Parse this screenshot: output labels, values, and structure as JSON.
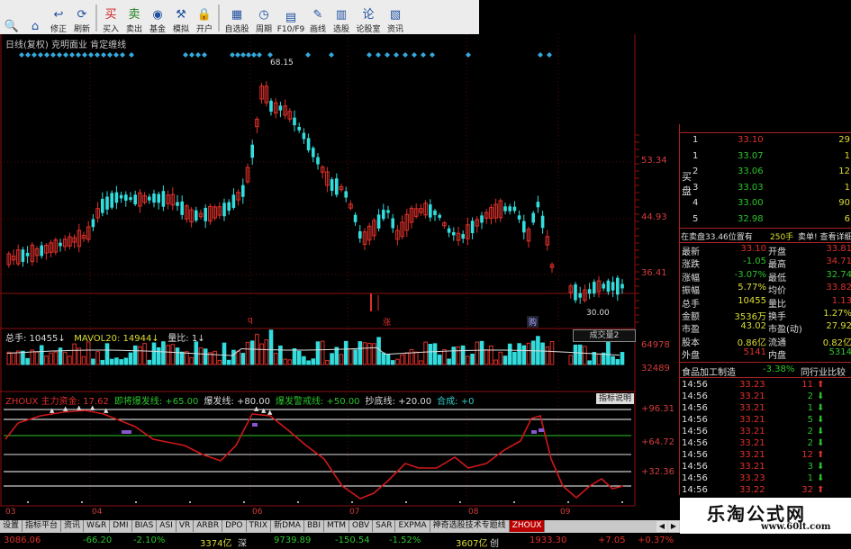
{
  "toolbar": {
    "buttons": [
      {
        "label": "",
        "icon": "search-icon",
        "glyph": "🔍"
      },
      {
        "label": "",
        "icon": "home-icon",
        "glyph": "⌂"
      },
      {
        "label": "修正",
        "icon": "back-arrow-icon",
        "glyph": "↩"
      },
      {
        "label": "刷新",
        "icon": "refresh-icon",
        "glyph": "⟳"
      },
      {
        "label": "买入",
        "icon": "buy-icon",
        "glyph": "买"
      },
      {
        "label": "卖出",
        "icon": "sell-icon",
        "glyph": "卖"
      },
      {
        "label": "基金",
        "icon": "fund-icon",
        "glyph": "◉"
      },
      {
        "label": "模拟",
        "icon": "simulate-icon",
        "glyph": "⚒"
      },
      {
        "label": "开户",
        "icon": "lock-icon",
        "glyph": "🔒"
      },
      {
        "label": "自选股",
        "icon": "favorite-icon",
        "glyph": "▦"
      },
      {
        "label": "周期",
        "icon": "period-icon",
        "glyph": "◷"
      },
      {
        "label": "F10/F9",
        "icon": "f10-icon",
        "glyph": "▤"
      },
      {
        "label": "画线",
        "icon": "draw-line-icon",
        "glyph": "✎"
      },
      {
        "label": "选股",
        "icon": "stock-pick-icon",
        "glyph": "▥"
      },
      {
        "label": "论股室",
        "icon": "forum-icon",
        "glyph": "论"
      },
      {
        "label": "资讯",
        "icon": "news-icon",
        "glyph": "▧"
      }
    ]
  },
  "chart": {
    "title": "日线(复权) 克明面业 肯定缠线",
    "price_labels": [
      "53.34",
      "44.93",
      "36.41"
    ],
    "high_label": "68.15",
    "low_label": "30.00",
    "month_labels": [
      "03",
      "04",
      "06",
      "07",
      "08",
      "09"
    ],
    "event_markers": [
      "q",
      "涨",
      "购"
    ]
  },
  "volume": {
    "header": {
      "total_label": "总手: 10455",
      "mavol_label": "MAVOL20: 14944",
      "ratio_label": "量比: 1"
    },
    "axis_labels": [
      "64978",
      "32489"
    ],
    "button_label": "成交量2"
  },
  "indicator": {
    "name": "ZHOUX",
    "items": [
      {
        "label": "主力资金:",
        "value": "17.62",
        "color": "#e0302a"
      },
      {
        "label": "即将爆发线:",
        "value": "+65.00",
        "color": "#2cc52c"
      },
      {
        "label": "爆发线:",
        "value": "+80.00",
        "color": "#dddddd"
      },
      {
        "label": "爆发警戒线:",
        "value": "+50.00",
        "color": "#2cc52c"
      },
      {
        "label": "抄底线:",
        "value": "+20.00",
        "color": "#dddddd"
      },
      {
        "label": "合成:",
        "value": "+0",
        "color": "#33cccc"
      }
    ],
    "axis_labels": [
      "+96.31",
      "+64.72",
      "+32.36"
    ],
    "help_label": "指标说明"
  },
  "quote_panel": {
    "book_label_buy": "买",
    "book_label_pan": "盘",
    "book_rows": [
      {
        "level": "1",
        "price": "33.10",
        "vol": "29",
        "pcolor": "#e0302a"
      },
      {
        "level": "1",
        "price": "33.07",
        "vol": "1",
        "pcolor": "#2cc52c"
      },
      {
        "level": "2",
        "price": "33.06",
        "vol": "12",
        "pcolor": "#2cc52c"
      },
      {
        "level": "3",
        "price": "33.03",
        "vol": "1",
        "pcolor": "#2cc52c"
      },
      {
        "level": "4",
        "price": "33.00",
        "vol": "90",
        "pcolor": "#2cc52c"
      },
      {
        "level": "5",
        "price": "32.98",
        "vol": "6",
        "pcolor": "#2cc52c"
      }
    ],
    "banner": {
      "left": "在卖盘33.46位置有",
      "mid": "250手",
      "right": "卖单! 查看详细"
    },
    "stats": [
      {
        "k1": "最新",
        "v1": "33.10",
        "c1": "#e0302a",
        "k2": "开盘",
        "v2": "33.81",
        "c2": "#e0302a"
      },
      {
        "k1": "涨跌",
        "v1": "-1.05",
        "c1": "#2cc52c",
        "k2": "最高",
        "v2": "34.71",
        "c2": "#e0302a"
      },
      {
        "k1": "涨幅",
        "v1": "-3.07%",
        "c1": "#2cc52c",
        "k2": "最低",
        "v2": "32.74",
        "c2": "#2cc52c"
      },
      {
        "k1": "振幅",
        "v1": "5.77%",
        "c1": "#dddd33",
        "k2": "均价",
        "v2": "33.82",
        "c2": "#e0302a"
      },
      {
        "k1": "总手",
        "v1": "10455",
        "c1": "#dddd33",
        "k2": "量比",
        "v2": "1.13",
        "c2": "#e0302a"
      },
      {
        "k1": "金额",
        "v1": "3536万",
        "c1": "#dddd33",
        "k2": "换手",
        "v2": "1.27%",
        "c2": "#dddd33"
      },
      {
        "k1": "市盈",
        "v1": "43.02",
        "c1": "#dddd33",
        "k2": "市盈(动)",
        "v2": "27.92",
        "c2": "#dddd33"
      },
      {
        "k1": "股本",
        "v1": "0.86亿",
        "c1": "#dddd33",
        "k2": "流通",
        "v2": "0.82亿",
        "c2": "#dddd33"
      },
      {
        "k1": "外盘",
        "v1": "5141",
        "c1": "#e0302a",
        "k2": "内盘",
        "v2": "5314",
        "c2": "#2cc52c"
      }
    ],
    "sector": {
      "name": "食品加工制造",
      "change": "-3.38%",
      "compare": "同行业比较"
    },
    "ticks": [
      {
        "time": "14:56",
        "price": "33.23",
        "vol": "11",
        "dir": "up"
      },
      {
        "time": "14:56",
        "price": "33.21",
        "vol": "2",
        "dir": "down"
      },
      {
        "time": "14:56",
        "price": "33.21",
        "vol": "1",
        "dir": "down"
      },
      {
        "time": "14:56",
        "price": "33.21",
        "vol": "5",
        "dir": "down"
      },
      {
        "time": "14:56",
        "price": "33.21",
        "vol": "2",
        "dir": "down"
      },
      {
        "time": "14:56",
        "price": "33.21",
        "vol": "2",
        "dir": "down"
      },
      {
        "time": "14:56",
        "price": "33.21",
        "vol": "12",
        "dir": "up"
      },
      {
        "time": "14:56",
        "price": "33.21",
        "vol": "3",
        "dir": "down"
      },
      {
        "time": "14:56",
        "price": "33.23",
        "vol": "1",
        "dir": "down"
      },
      {
        "time": "14:56",
        "price": "33.22",
        "vol": "32",
        "dir": "up"
      }
    ]
  },
  "tabs": [
    "设置",
    "指标平台",
    "资讯",
    "W&R",
    "DMI",
    "BIAS",
    "ASI",
    "VR",
    "ARBR",
    "DPO",
    "TRIX",
    "新DMA",
    "BBI",
    "MTM",
    "OBV",
    "SAR",
    "EXPMA",
    "神奇选股技术专题线",
    "ZHOUX"
  ],
  "active_tab": "ZHOUX",
  "status": {
    "sh_index": "3086.06",
    "sh_change": "-66.20",
    "sh_pct": "-2.10%",
    "sh_amount": "3374亿",
    "sz_label": "深",
    "sz_index": "9739.89",
    "sz_change": "-150.54",
    "sz_pct": "-1.52%",
    "sz_amount": "3607亿",
    "cy_label": "创",
    "cy_index": "1933.30",
    "cy_change": "+7.05",
    "cy_pct": "+0.37%"
  },
  "watermark": {
    "title": "乐淘公式网",
    "url": "www.60lt.com"
  },
  "colors": {
    "up": "#e0302a",
    "down": "#33dddd",
    "grid": "#7a1010",
    "accent": "#b00000"
  }
}
